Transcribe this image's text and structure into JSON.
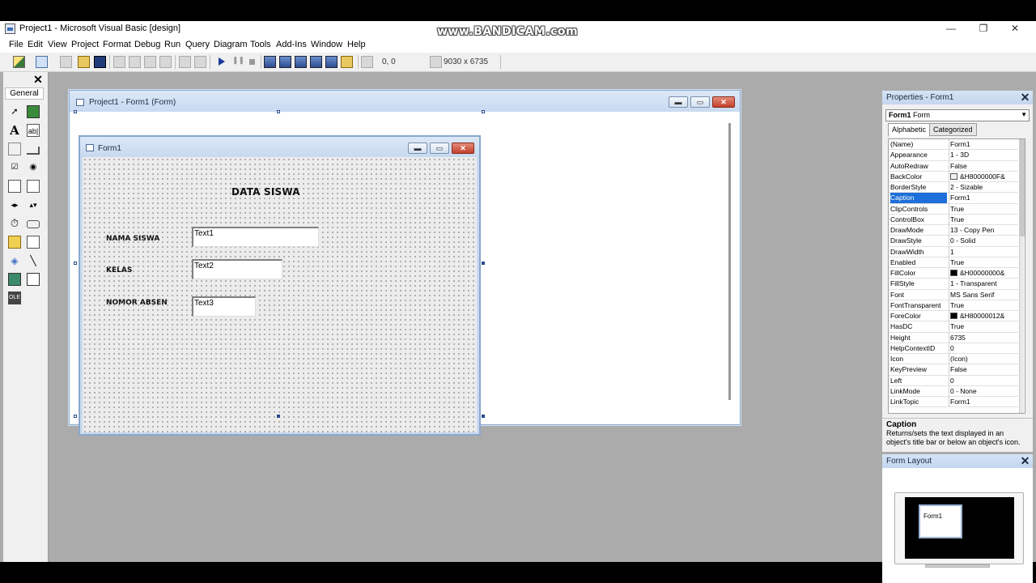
{
  "window": {
    "title": "Project1 - Microsoft Visual Basic [design]",
    "watermark": "www.BANDICAM.com",
    "minimize": "—",
    "restore": "❐",
    "close": "✕"
  },
  "menu": [
    "File",
    "Edit",
    "View",
    "Project",
    "Format",
    "Debug",
    "Run",
    "Query",
    "Diagram",
    "Tools",
    "Add-Ins",
    "Window",
    "Help"
  ],
  "toolbar": {
    "position": "0, 0",
    "size": "9030 x 6735"
  },
  "toolbox": {
    "close": "✕",
    "tab": "General",
    "tools": [
      "pointer-icon",
      "picturebox-icon",
      "label-icon",
      "textbox-icon",
      "frame-icon",
      "commandbutton-icon",
      "checkbox-icon",
      "optionbutton-icon",
      "combobox-icon",
      "listbox-icon",
      "hscrollbar-icon",
      "vscrollbar-icon",
      "timer-icon",
      "drivelistbox-icon",
      "dirlistbox-icon",
      "filelistbox-icon",
      "shape-icon",
      "line-icon",
      "image-icon",
      "data-icon",
      "ole-icon"
    ]
  },
  "project_window": {
    "title": "Project1 - Form1 (Form)"
  },
  "form1": {
    "title": "Form1",
    "heading": "DATA SISWA",
    "labels": {
      "nama": "NAMA SISWA",
      "kelas": "KELAS",
      "absen": "NOMOR ABSEN"
    },
    "textboxes": {
      "text1": "Text1",
      "text2": "Text2",
      "text3": "Text3"
    }
  },
  "properties": {
    "title": "Properties - Form1",
    "close": "✕",
    "object_name": "Form1",
    "object_type": "Form",
    "tab_alphabetic": "Alphabetic",
    "tab_categorized": "Categorized",
    "rows": [
      {
        "name": "(Name)",
        "value": "Form1"
      },
      {
        "name": "Appearance",
        "value": "1 - 3D"
      },
      {
        "name": "AutoRedraw",
        "value": "False"
      },
      {
        "name": "BackColor",
        "value": "&H8000000F&",
        "swatch": "#f0f0f0"
      },
      {
        "name": "BorderStyle",
        "value": "2 - Sizable"
      },
      {
        "name": "Caption",
        "value": "Form1",
        "selected": true
      },
      {
        "name": "ClipControls",
        "value": "True"
      },
      {
        "name": "ControlBox",
        "value": "True"
      },
      {
        "name": "DrawMode",
        "value": "13 - Copy Pen"
      },
      {
        "name": "DrawStyle",
        "value": "0 - Solid"
      },
      {
        "name": "DrawWidth",
        "value": "1"
      },
      {
        "name": "Enabled",
        "value": "True"
      },
      {
        "name": "FillColor",
        "value": "&H00000000&",
        "swatch": "#000000"
      },
      {
        "name": "FillStyle",
        "value": "1 - Transparent"
      },
      {
        "name": "Font",
        "value": "MS Sans Serif"
      },
      {
        "name": "FontTransparent",
        "value": "True"
      },
      {
        "name": "ForeColor",
        "value": "&H80000012&",
        "swatch": "#000000"
      },
      {
        "name": "HasDC",
        "value": "True"
      },
      {
        "name": "Height",
        "value": "6735"
      },
      {
        "name": "HelpContextID",
        "value": "0"
      },
      {
        "name": "Icon",
        "value": "(Icon)"
      },
      {
        "name": "KeyPreview",
        "value": "False"
      },
      {
        "name": "Left",
        "value": "0"
      },
      {
        "name": "LinkMode",
        "value": "0 - None"
      },
      {
        "name": "LinkTopic",
        "value": "Form1"
      }
    ],
    "desc_title": "Caption",
    "desc_text": "Returns/sets the text displayed in an object's title bar or below an object's icon."
  },
  "form_layout": {
    "title": "Form Layout",
    "close": "✕",
    "form_label": "Form1"
  },
  "colors": {
    "selection": "#1e6fd9",
    "workspace": "#ababab",
    "titlebar": "#c8daf0"
  }
}
